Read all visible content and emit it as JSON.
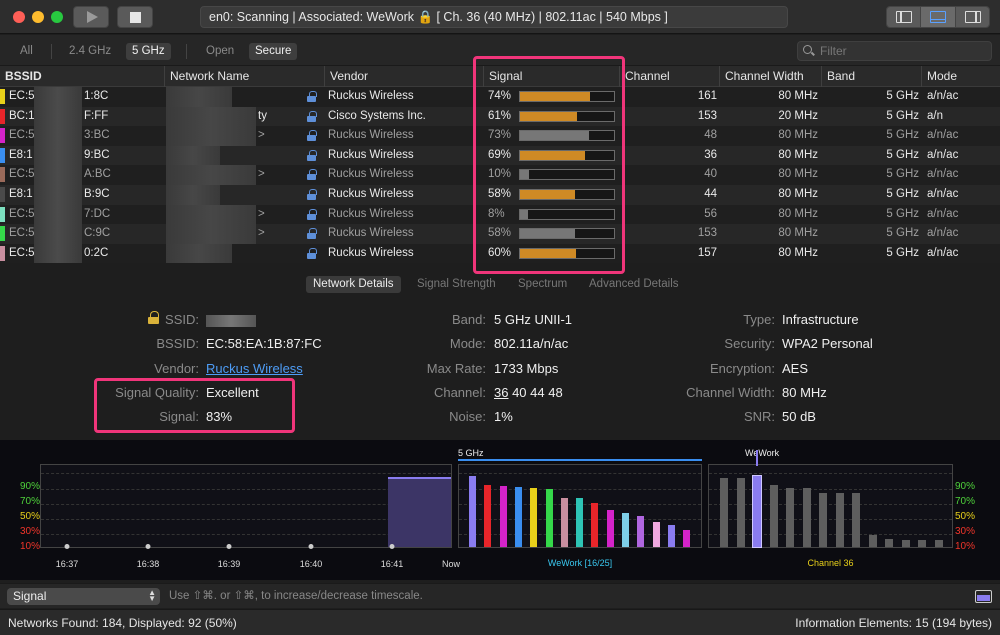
{
  "toolbar": {
    "status_text": "en0: Scanning  |  Associated: WeWork 🔒 [ Ch. 36 (40 MHz) | 802.11ac | 540 Mbps ]"
  },
  "filters": {
    "all": "All",
    "ghz24": "2.4 GHz",
    "ghz5": "5 GHz",
    "open": "Open",
    "secure": "Secure",
    "search_placeholder": "Filter"
  },
  "columns": {
    "bssid": "BSSID",
    "network_name": "Network Name",
    "vendor": "Vendor",
    "signal": "Signal",
    "channel": "Channel",
    "channel_width": "Channel Width",
    "band": "Band",
    "mode": "Mode"
  },
  "rows": [
    {
      "bssid_a": "EC:5",
      "bssid_b": "1:8C",
      "name_tail": "",
      "vendor": "Ruckus Wireless",
      "signal_text": "74%",
      "signal": 0.74,
      "channel": "161",
      "width": "80 MHz",
      "band": "5 GHz",
      "mode": "a/n/ac",
      "swatch": "#e8d01a",
      "bar": "#cf8a25",
      "bright": true
    },
    {
      "bssid_a": "BC:1",
      "bssid_b": "F:FF",
      "name_tail": "ty",
      "vendor": "Cisco Systems Inc.",
      "signal_text": "61%",
      "signal": 0.61,
      "channel": "153",
      "width": "20 MHz",
      "band": "5 GHz",
      "mode": "a/n",
      "swatch": "#e8252a",
      "bar": "#cf8a25",
      "bright": true
    },
    {
      "bssid_a": "EC:5",
      "bssid_b": "3:BC",
      "name_tail": ">",
      "vendor": "Ruckus Wireless",
      "signal_text": "73%",
      "signal": 0.73,
      "channel": "48",
      "width": "80 MHz",
      "band": "5 GHz",
      "mode": "a/n/ac",
      "swatch": "#d423c9",
      "bar": "#777777",
      "bright": false
    },
    {
      "bssid_a": "E8:1",
      "bssid_b": "9:BC",
      "name_tail": "",
      "vendor": "Ruckus Wireless",
      "signal_text": "69%",
      "signal": 0.69,
      "channel": "36",
      "width": "80 MHz",
      "band": "5 GHz",
      "mode": "a/n/ac",
      "swatch": "#3a8ef0",
      "bar": "#cf8a25",
      "bright": true
    },
    {
      "bssid_a": "EC:5",
      "bssid_b": "A:BC",
      "name_tail": ">",
      "vendor": "Ruckus Wireless",
      "signal_text": "10%",
      "signal": 0.1,
      "channel": "40",
      "width": "80 MHz",
      "band": "5 GHz",
      "mode": "a/n/ac",
      "swatch": "#9a6a5a",
      "bar": "#777777",
      "bright": false
    },
    {
      "bssid_a": "E8:1",
      "bssid_b": "B:9C",
      "name_tail": "",
      "vendor": "Ruckus Wireless",
      "signal_text": "58%",
      "signal": 0.58,
      "channel": "44",
      "width": "80 MHz",
      "band": "5 GHz",
      "mode": "a/n/ac",
      "swatch": "#4a4a4a",
      "bar": "#cf8a25",
      "bright": true
    },
    {
      "bssid_a": "EC:5",
      "bssid_b": "7:DC",
      "name_tail": ">",
      "vendor": "Ruckus Wireless",
      "signal_text": "8%",
      "signal": 0.08,
      "channel": "56",
      "width": "80 MHz",
      "band": "5 GHz",
      "mode": "a/n/ac",
      "swatch": "#7de0c0",
      "bar": "#777777",
      "bright": false
    },
    {
      "bssid_a": "EC:5",
      "bssid_b": "C:9C",
      "name_tail": ">",
      "vendor": "Ruckus Wireless",
      "signal_text": "58%",
      "signal": 0.58,
      "channel": "153",
      "width": "80 MHz",
      "band": "5 GHz",
      "mode": "a/n/ac",
      "swatch": "#35d84a",
      "bar": "#777777",
      "bright": false
    },
    {
      "bssid_a": "EC:5",
      "bssid_b": "0:2C",
      "name_tail": "",
      "vendor": "Ruckus Wireless",
      "signal_text": "60%",
      "signal": 0.6,
      "channel": "157",
      "width": "80 MHz",
      "band": "5 GHz",
      "mode": "a/n/ac",
      "swatch": "#c98fa0",
      "bar": "#cf8a25",
      "bright": true
    }
  ],
  "tabs": {
    "details": "Network Details",
    "strength": "Signal Strength",
    "spectrum": "Spectrum",
    "advanced": "Advanced Details"
  },
  "details": {
    "ssid_label": "SSID:",
    "bssid_label": "BSSID:",
    "bssid_value": "EC:58:EA:1B:87:FC",
    "vendor_label": "Vendor:",
    "vendor_value": "Ruckus Wireless",
    "quality_label": "Signal Quality:",
    "quality_value": "Excellent",
    "signal_label": "Signal:",
    "signal_value": "83%",
    "band_label": "Band:",
    "band_value": "5 GHz UNII-1",
    "mode_label": "Mode:",
    "mode_value": "802.11a/n/ac",
    "maxrate_label": "Max Rate:",
    "maxrate_value": "1733 Mbps",
    "channel_label": "Channel:",
    "channel_primary": "36",
    "channel_rest": " 40 44 48",
    "noise_label": "Noise:",
    "noise_value": "1%",
    "type_label": "Type:",
    "type_value": "Infrastructure",
    "security_label": "Security:",
    "security_value": "WPA2 Personal",
    "encryption_label": "Encryption:",
    "encryption_value": "AES",
    "chwidth_label": "Channel Width:",
    "chwidth_value": "80 MHz",
    "snr_label": "SNR:",
    "snr_value": "50 dB"
  },
  "graphs": {
    "y_labels": [
      "90%",
      "70%",
      "50%",
      "30%",
      "10%"
    ],
    "y_colors": [
      "#4ed13a",
      "#4ed13a",
      "#e8d01a",
      "#f0352a",
      "#f0352a"
    ],
    "time_ticks": [
      "16:37",
      "16:38",
      "16:39",
      "16:40",
      "16:41",
      "Now"
    ],
    "history_level": 0.83,
    "spectrum_title": "5 GHz",
    "spectrum_caption": "WeWork [16/25]",
    "spectrum_bars": [
      {
        "color": "#8a7cf0",
        "value": 0.84
      },
      {
        "color": "#e8252a",
        "value": 0.74
      },
      {
        "color": "#d423c9",
        "value": 0.73
      },
      {
        "color": "#3a8ef0",
        "value": 0.72
      },
      {
        "color": "#e8d01a",
        "value": 0.7
      },
      {
        "color": "#35d84a",
        "value": 0.69
      },
      {
        "color": "#c98fa0",
        "value": 0.58
      },
      {
        "color": "#2ec4b6",
        "value": 0.58
      },
      {
        "color": "#e8252a",
        "value": 0.52
      },
      {
        "color": "#d423c9",
        "value": 0.44
      },
      {
        "color": "#7ecfe8",
        "value": 0.4
      },
      {
        "color": "#b066e0",
        "value": 0.37
      },
      {
        "color": "#f0a8e0",
        "value": 0.3
      },
      {
        "color": "#8a7cf0",
        "value": 0.26
      },
      {
        "color": "#d423c9",
        "value": 0.2
      }
    ],
    "channel_title": "WeWork",
    "channel_caption": "Channel 36",
    "channel_bars": [
      0.82,
      0.82,
      0.84,
      0.74,
      0.7,
      0.7,
      0.64,
      0.64,
      0.64,
      0.14,
      0.1,
      0.08,
      0.08,
      0.08
    ],
    "channel_highlight_index": 2
  },
  "bottom": {
    "select_value": "Signal",
    "hint": "Use ⇧⌘. or ⇧⌘, to increase/decrease timescale."
  },
  "statusbar": {
    "left": "Networks Found: 184, Displayed: 92 (50%)",
    "right": "Information Elements: 15 (194 bytes)"
  }
}
